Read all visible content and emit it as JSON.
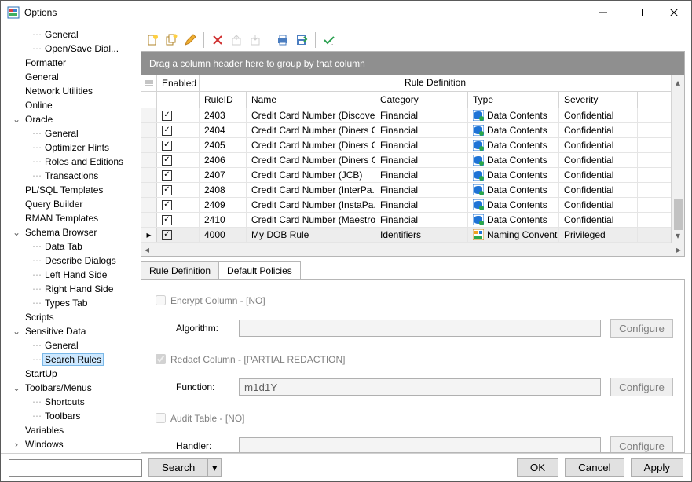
{
  "window": {
    "title": "Options"
  },
  "tree": [
    {
      "label": "General",
      "depth": 2
    },
    {
      "label": "Open/Save Dial...",
      "depth": 2
    },
    {
      "label": "Formatter",
      "depth": 1
    },
    {
      "label": "General",
      "depth": 1
    },
    {
      "label": "Network Utilities",
      "depth": 1
    },
    {
      "label": "Online",
      "depth": 1
    },
    {
      "label": "Oracle",
      "depth": 1,
      "twisty": "v"
    },
    {
      "label": "General",
      "depth": 2
    },
    {
      "label": "Optimizer Hints",
      "depth": 2
    },
    {
      "label": "Roles and Editions",
      "depth": 2
    },
    {
      "label": "Transactions",
      "depth": 2
    },
    {
      "label": "PL/SQL Templates",
      "depth": 1
    },
    {
      "label": "Query Builder",
      "depth": 1
    },
    {
      "label": "RMAN Templates",
      "depth": 1
    },
    {
      "label": "Schema Browser",
      "depth": 1,
      "twisty": "v"
    },
    {
      "label": "Data Tab",
      "depth": 2
    },
    {
      "label": "Describe Dialogs",
      "depth": 2
    },
    {
      "label": "Left Hand Side",
      "depth": 2
    },
    {
      "label": "Right Hand Side",
      "depth": 2
    },
    {
      "label": "Types Tab",
      "depth": 2
    },
    {
      "label": "Scripts",
      "depth": 1
    },
    {
      "label": "Sensitive Data",
      "depth": 1,
      "twisty": "v"
    },
    {
      "label": "General",
      "depth": 2
    },
    {
      "label": "Search Rules",
      "depth": 2,
      "selected": true
    },
    {
      "label": "StartUp",
      "depth": 1
    },
    {
      "label": "Toolbars/Menus",
      "depth": 1,
      "twisty": "v"
    },
    {
      "label": "Shortcuts",
      "depth": 2
    },
    {
      "label": "Toolbars",
      "depth": 2
    },
    {
      "label": "Variables",
      "depth": 1
    },
    {
      "label": "Windows",
      "depth": 1,
      "twisty": ">"
    }
  ],
  "group_hint": "Drag a column header here to group by that column",
  "grid": {
    "group_title": "Rule Definition",
    "columns": {
      "enabled": "Enabled",
      "ruleid": "RuleID",
      "name": "Name",
      "category": "Category",
      "type": "Type",
      "severity": "Severity"
    },
    "rows": [
      {
        "enabled": true,
        "ruleid": "2403",
        "name": "Credit Card Number (Discover)",
        "category": "Financial",
        "type": "Data Contents",
        "type_icon": "dc",
        "severity": "Confidential"
      },
      {
        "enabled": true,
        "ruleid": "2404",
        "name": "Credit Card Number (Diners C...",
        "category": "Financial",
        "type": "Data Contents",
        "type_icon": "dc",
        "severity": "Confidential"
      },
      {
        "enabled": true,
        "ruleid": "2405",
        "name": "Credit Card Number (Diners C...",
        "category": "Financial",
        "type": "Data Contents",
        "type_icon": "dc",
        "severity": "Confidential"
      },
      {
        "enabled": true,
        "ruleid": "2406",
        "name": "Credit Card Number (Diners C...",
        "category": "Financial",
        "type": "Data Contents",
        "type_icon": "dc",
        "severity": "Confidential"
      },
      {
        "enabled": true,
        "ruleid": "2407",
        "name": "Credit Card Number (JCB)",
        "category": "Financial",
        "type": "Data Contents",
        "type_icon": "dc",
        "severity": "Confidential"
      },
      {
        "enabled": true,
        "ruleid": "2408",
        "name": "Credit Card Number (InterPa...",
        "category": "Financial",
        "type": "Data Contents",
        "type_icon": "dc",
        "severity": "Confidential"
      },
      {
        "enabled": true,
        "ruleid": "2409",
        "name": "Credit Card Number (InstaPa...",
        "category": "Financial",
        "type": "Data Contents",
        "type_icon": "dc",
        "severity": "Confidential"
      },
      {
        "enabled": true,
        "ruleid": "2410",
        "name": "Credit Card Number (Maestro...",
        "category": "Financial",
        "type": "Data Contents",
        "type_icon": "dc",
        "severity": "Confidential"
      },
      {
        "enabled": true,
        "ruleid": "4000",
        "name": "My DOB Rule",
        "category": "Identifiers",
        "type": "Naming Convention",
        "type_icon": "nc",
        "severity": "Privileged",
        "selected": true,
        "indicator": "▸"
      }
    ]
  },
  "tabs": {
    "rule_def": "Rule Definition",
    "default_policies": "Default Policies"
  },
  "policies": {
    "encrypt_label": "Encrypt Column - [NO]",
    "algorithm_label": "Algorithm:",
    "algorithm_value": "",
    "redact_label": "Redact Column - [PARTIAL REDACTION]",
    "function_label": "Function:",
    "function_value": "m1d1Y",
    "audit_label": "Audit Table - [NO]",
    "handler_label": "Handler:",
    "handler_value": "",
    "configure": "Configure"
  },
  "footer": {
    "search": "Search",
    "ok": "OK",
    "cancel": "Cancel",
    "apply": "Apply"
  },
  "icons": {
    "dc_color1": "#1e73d6",
    "dc_color2": "#2aa84a",
    "nc_color1": "#f0a020",
    "nc_color2": "#1e73d6"
  }
}
